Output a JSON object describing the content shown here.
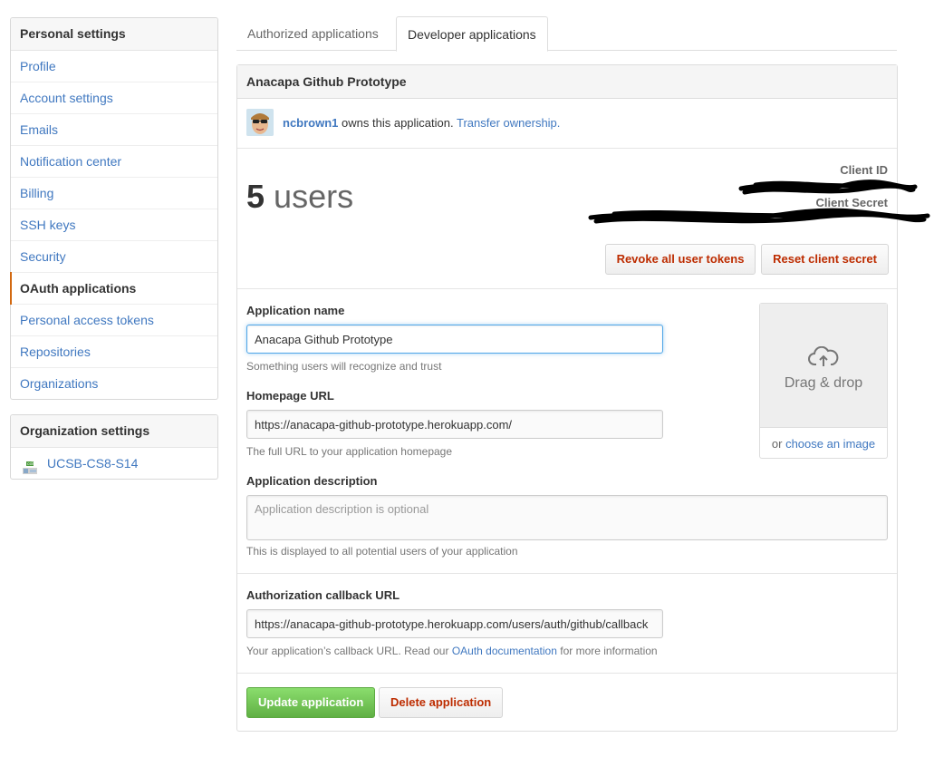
{
  "personal_settings": {
    "heading": "Personal settings",
    "items": [
      {
        "label": "Profile"
      },
      {
        "label": "Account settings"
      },
      {
        "label": "Emails"
      },
      {
        "label": "Notification center"
      },
      {
        "label": "Billing"
      },
      {
        "label": "SSH keys"
      },
      {
        "label": "Security"
      },
      {
        "label": "OAuth applications"
      },
      {
        "label": "Personal access tokens"
      },
      {
        "label": "Repositories"
      },
      {
        "label": "Organizations"
      }
    ],
    "selected": "OAuth applications"
  },
  "organization_settings": {
    "heading": "Organization settings",
    "items": [
      {
        "label": "UCSB-CS8-S14",
        "icon": "organization-avatar-icon"
      }
    ]
  },
  "tabs": [
    {
      "label": "Authorized applications",
      "active": false
    },
    {
      "label": "Developer applications",
      "active": true
    }
  ],
  "app": {
    "title": "Anacapa Github Prototype",
    "owner": "ncbrown1",
    "owns_text": "owns this application.",
    "transfer_link": "Transfer ownership.",
    "user_count": "5",
    "users_label": "users",
    "client_id_label": "Client ID",
    "client_secret_label": "Client Secret",
    "revoke_button": "Revoke all user tokens",
    "reset_button": "Reset client secret"
  },
  "form": {
    "name": {
      "label": "Application name",
      "value": "Anacapa Github Prototype",
      "note": "Something users will recognize and trust"
    },
    "homepage": {
      "label": "Homepage URL",
      "value": "https://anacapa-github-prototype.herokuapp.com/",
      "note": "The full URL to your application homepage"
    },
    "description": {
      "label": "Application description",
      "placeholder": "Application description is optional",
      "note": "This is displayed to all potential users of your application"
    },
    "callback": {
      "label": "Authorization callback URL",
      "value": "https://anacapa-github-prototype.herokuapp.com/users/auth/github/callback",
      "note_prefix": "Your application’s callback URL. Read our",
      "note_link": "OAuth documentation",
      "note_suffix": "for more information"
    },
    "dropzone": {
      "text": "Drag & drop",
      "or_text": "or",
      "link": "choose an image"
    }
  },
  "actions": {
    "update": "Update application",
    "delete": "Delete application"
  },
  "colors": {
    "link": "#4078c0",
    "danger": "#bd2c00",
    "primary": "#6cc644",
    "selected_indicator": "#d26911",
    "focus": "#51a7e8"
  }
}
